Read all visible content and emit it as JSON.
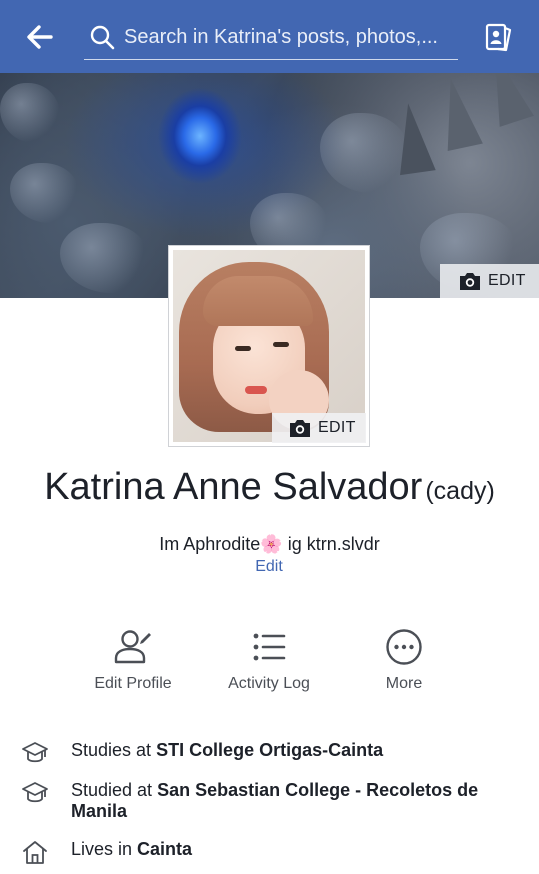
{
  "header": {
    "back_icon": "back-arrow-icon",
    "search_placeholder": "Search in Katrina's posts, photos,...",
    "search_icon": "search-icon",
    "profile_switch_icon": "profile-card-icon"
  },
  "cover": {
    "edit_label": "EDIT",
    "edit_icon": "camera-icon",
    "accent_color": "#2a6ae8"
  },
  "avatar": {
    "edit_label": "EDIT",
    "edit_icon": "camera-icon"
  },
  "profile": {
    "name": "Katrina Anne Salvador",
    "nickname": "(cady)",
    "bio_before": "Im Aphrodite",
    "bio_emoji": "🌸",
    "bio_after": " ig ktrn.slvdr",
    "bio_edit_label": "Edit"
  },
  "actions": [
    {
      "label": "Edit Profile",
      "icon": "edit-profile-icon"
    },
    {
      "label": "Activity Log",
      "icon": "activity-log-icon"
    },
    {
      "label": "More",
      "icon": "more-icon"
    }
  ],
  "about": [
    {
      "prefix": "Studies at ",
      "value": "STI College Ortigas-Cainta",
      "icon": "graduation-cap-icon"
    },
    {
      "prefix": "Studied at ",
      "value": "San Sebastian College - Recoletos de Manila",
      "icon": "graduation-cap-icon"
    },
    {
      "prefix": "Lives in ",
      "value": "Cainta",
      "icon": "home-icon"
    }
  ],
  "colors": {
    "brand_blue": "#4267b2",
    "text_primary": "#1d2129",
    "text_secondary": "#4b4f56"
  }
}
